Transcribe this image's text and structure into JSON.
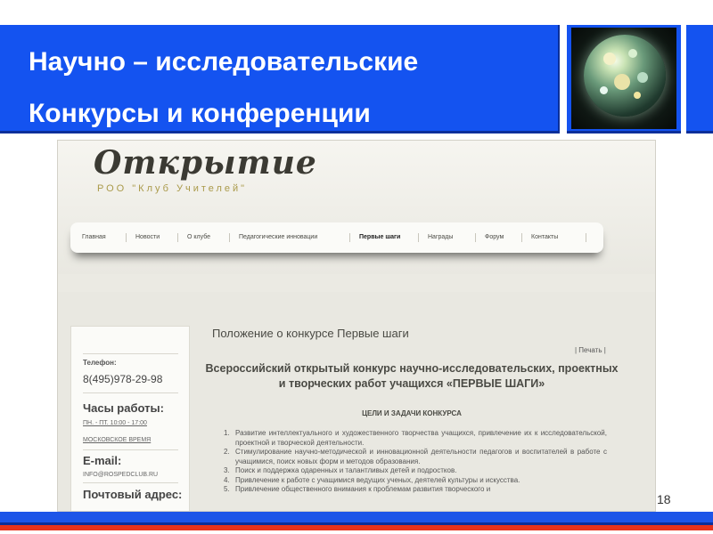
{
  "slide": {
    "title_line1": "Научно – исследовательские",
    "title_line2": "Конкурсы и конференции",
    "page_number": "18",
    "colors": {
      "header_blue": "#1453f0",
      "stripe_red": "#e8321b"
    }
  },
  "site": {
    "logo": "Открытие",
    "logo_subtitle": "РОО \"Клуб Учителей\"",
    "nav": [
      "Главная",
      "Новости",
      "О клубе",
      "Педагогические инновации",
      "Первые шаги",
      "Награды",
      "Форум",
      "Контакты"
    ],
    "active_nav": "Первые шаги",
    "sidebar": {
      "phone_label": "Телефон:",
      "phone": "8(495)978-29-98",
      "hours_heading": "Часы работы:",
      "hours": "ПН. - ПТ. 10:00 - 17:00",
      "timezone": "МОСКОВСКОЕ ВРЕМЯ",
      "email_heading": "E-mail:",
      "email": "INFO@ROSPEDCLUB.RU",
      "postal_heading": "Почтовый адрес:"
    },
    "main": {
      "page_title": "Положение о конкурсе Первые шаги",
      "print_link": "| Печать |",
      "contest_title": "Всероссийский открытый конкурс научно-исследовательских, проектных и творческих работ учащихся «ПЕРВЫЕ ШАГИ»",
      "goals_title": "ЦЕЛИ И ЗАДАЧИ КОНКУРСА",
      "goals": [
        "Развитие интеллектуального и художественного творчества учащихся, привлечение их к исследовательской, проектной и творческой деятельности.",
        "Стимулирование научно-методической и инновационной деятельности педагогов и воспитателей в работе с учащимися, поиск новых форм и методов образования.",
        "Поиск и поддержка одаренных и талантливых детей и подростков.",
        "Привлечение к работе с учащимися ведущих ученых, деятелей культуры и искусства.",
        "Привлечение общественного внимания к проблемам развития творческого и"
      ]
    }
  }
}
